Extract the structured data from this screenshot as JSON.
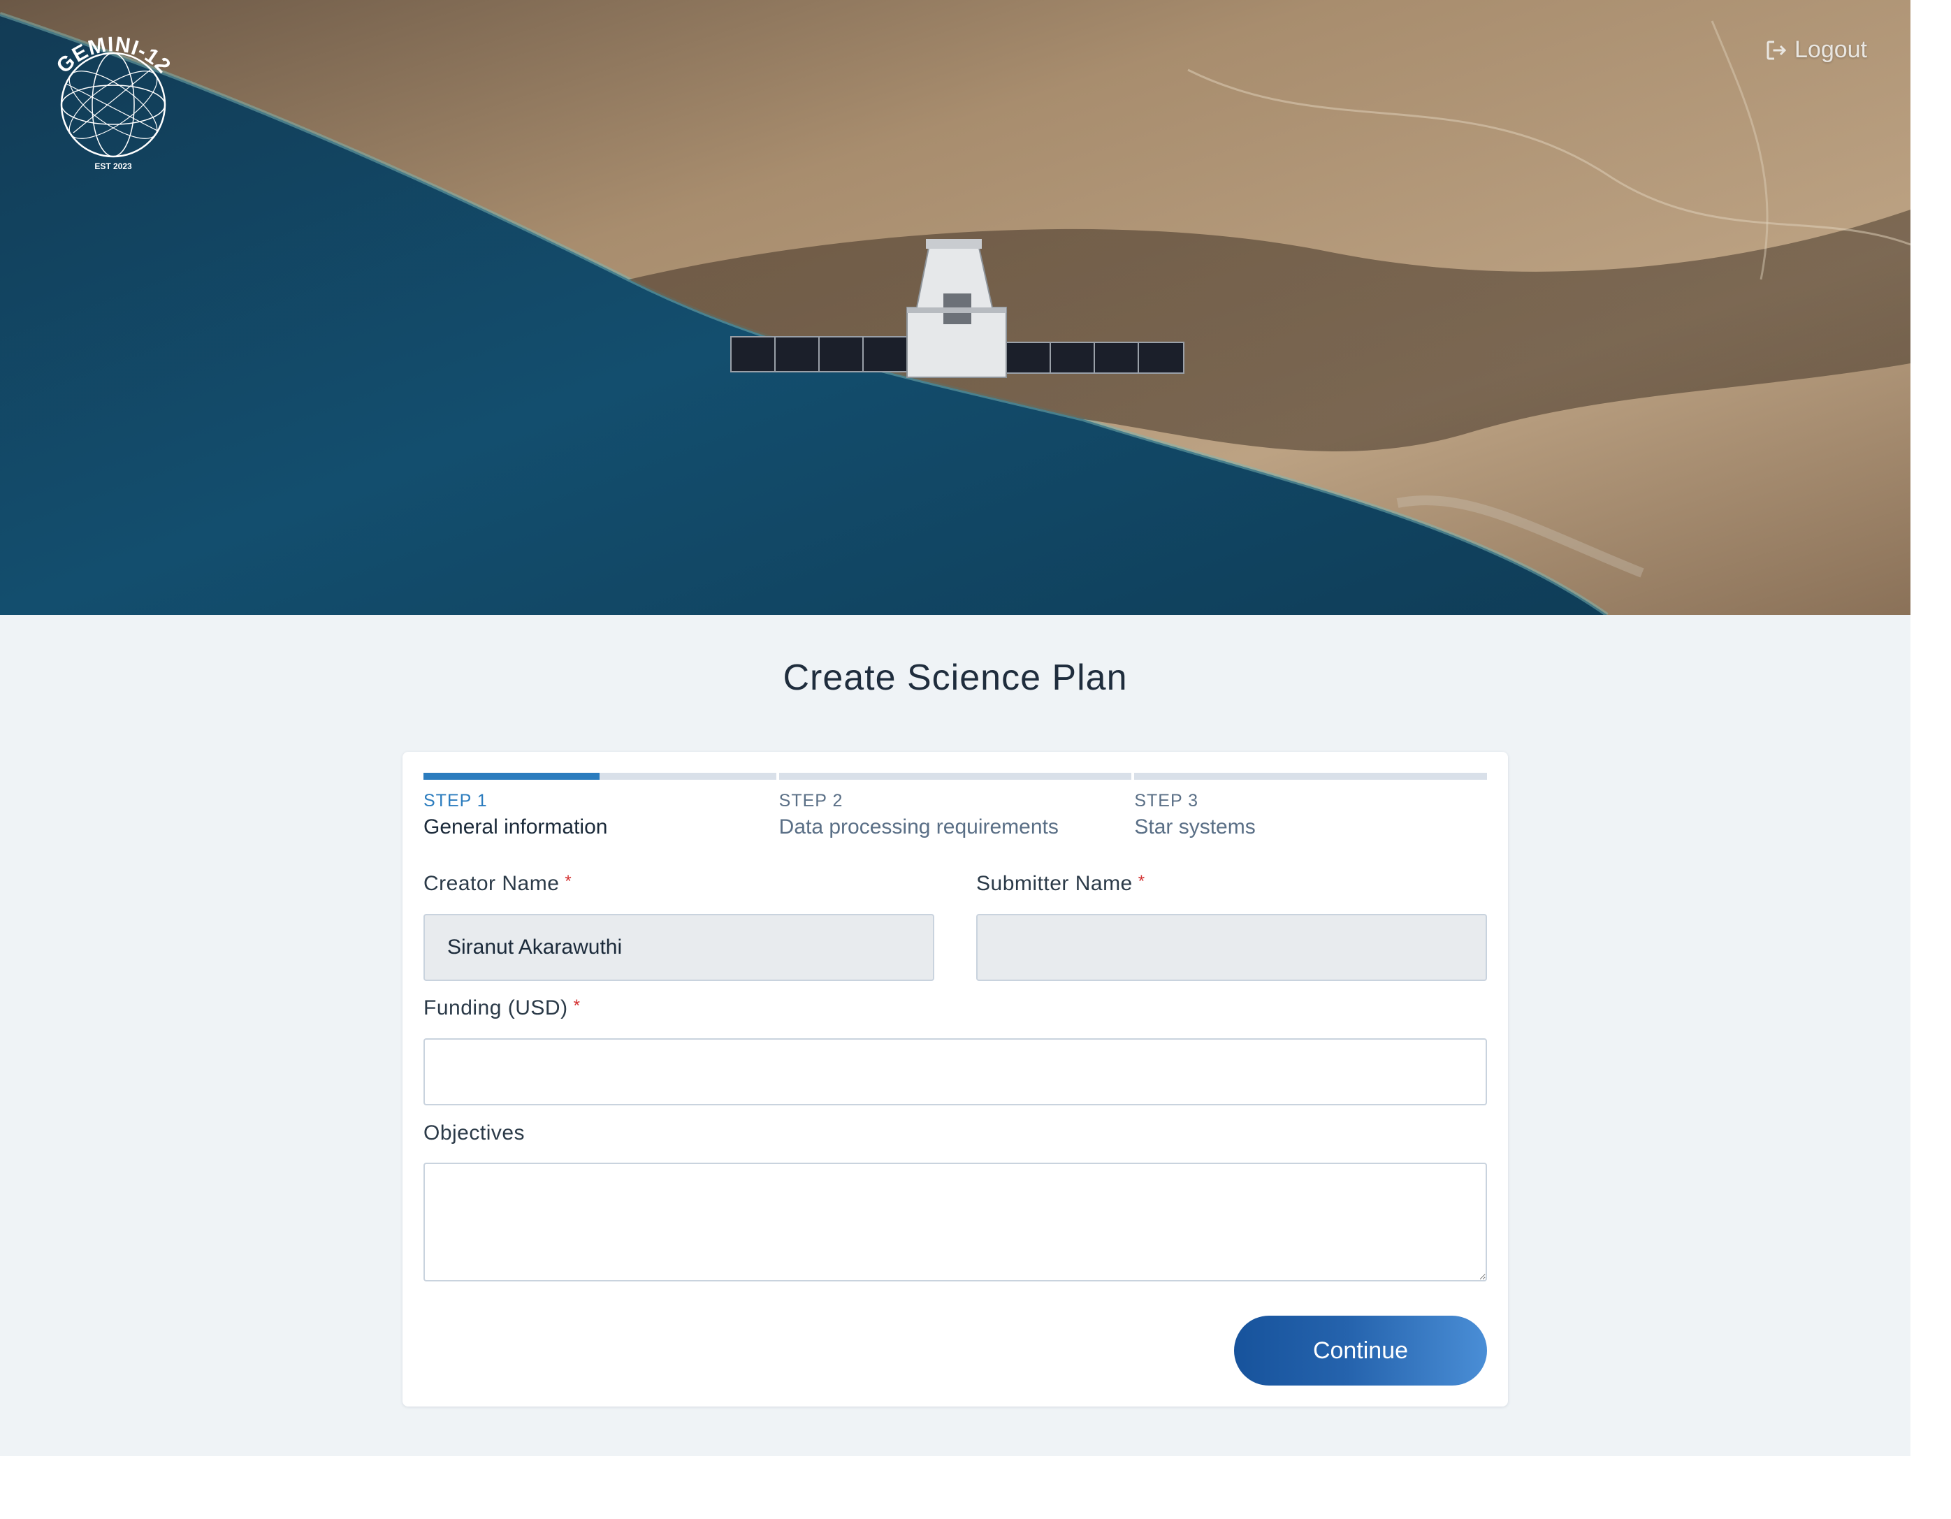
{
  "header": {
    "logo": {
      "text": "GEMINI-12",
      "est": "EST 2023"
    },
    "logout_label": "Logout"
  },
  "page_title": "Create Science Plan",
  "steps": [
    {
      "number": "STEP 1",
      "name": "General information",
      "progress": 0.5,
      "active": true
    },
    {
      "number": "STEP 2",
      "name": "Data processing requirements",
      "progress": 0,
      "active": false
    },
    {
      "number": "STEP 3",
      "name": "Star systems",
      "progress": 0,
      "active": false
    }
  ],
  "form": {
    "creator_name": {
      "label": "Creator Name",
      "required_mark": "*",
      "value": "Siranut Akarawuthi"
    },
    "submitter_name": {
      "label": "Submitter Name",
      "required_mark": "*",
      "value": ""
    },
    "funding": {
      "label": "Funding (USD)",
      "required_mark": "*",
      "value": ""
    },
    "objectives": {
      "label": "Objectives",
      "value": ""
    },
    "continue_label": "Continue"
  },
  "colors": {
    "accent": "#2b7cbe",
    "button_start": "#17539c",
    "button_end": "#4a8ed6",
    "page_bg": "#eff3f6",
    "required": "#d32f2f"
  }
}
